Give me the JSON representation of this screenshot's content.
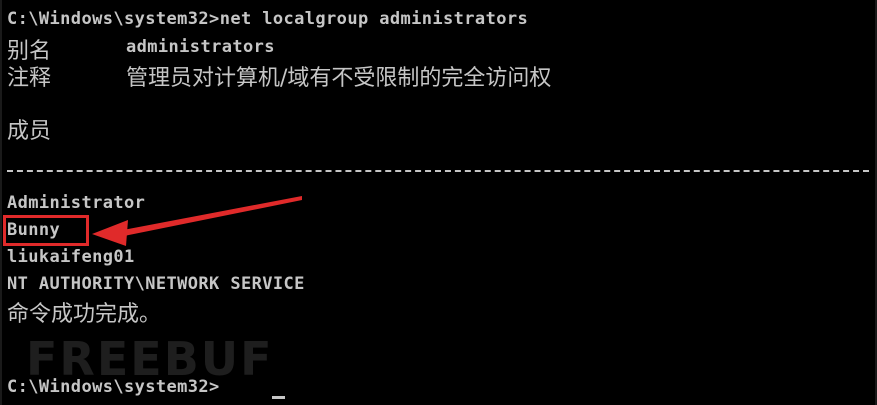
{
  "console": {
    "command_line": "C:\\Windows\\system32>net localgroup administrators",
    "alias_label": "别名",
    "alias_value": "administrators",
    "comment_label": "注释",
    "comment_value": "管理员对计算机/域有不受限制的完全访问权",
    "members_label": "成员",
    "members": [
      "Administrator",
      "Bunny",
      "liukaifeng01",
      "NT AUTHORITY\\NETWORK SERVICE"
    ],
    "completion_message": "命令成功完成。",
    "prompt": "C:\\Windows\\system32>"
  },
  "watermark": "FREEBUF",
  "colors": {
    "background": "#000000",
    "text": "#c6c6c6",
    "annotation": "#e02a2a"
  }
}
